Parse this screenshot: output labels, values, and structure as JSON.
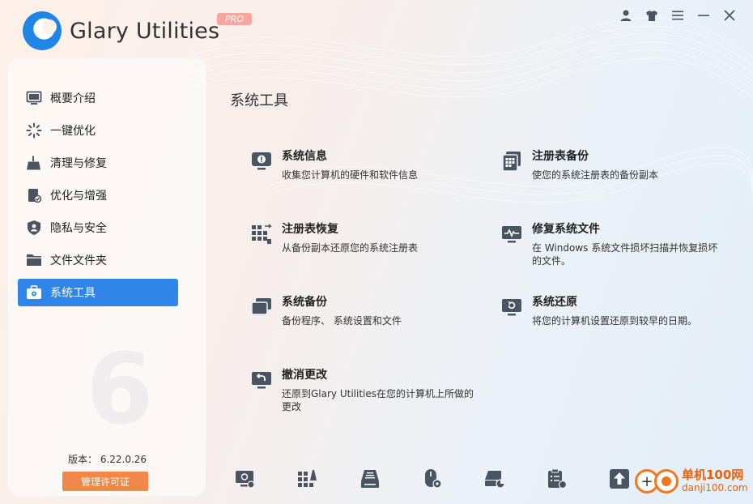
{
  "app": {
    "title": "Glary Utilities",
    "badge": "PRO"
  },
  "titlebar": {
    "icons": [
      "user-icon",
      "skin-icon",
      "menu-icon",
      "minimize-icon",
      "close-icon"
    ]
  },
  "sidebar": {
    "items": [
      {
        "label": "概要介绍",
        "icon": "monitor-icon"
      },
      {
        "label": "一键优化",
        "icon": "sparkle-icon"
      },
      {
        "label": "清理与修复",
        "icon": "broom-icon"
      },
      {
        "label": "优化与增强",
        "icon": "boost-icon"
      },
      {
        "label": "隐私与安全",
        "icon": "shield-icon"
      },
      {
        "label": "文件文件夹",
        "icon": "folder-icon"
      },
      {
        "label": "系统工具",
        "icon": "toolbox-icon",
        "active": true
      }
    ],
    "version_label": "版本： 6.22.0.26",
    "license_button": "管理许可证"
  },
  "main": {
    "section_title": "系统工具",
    "tools": [
      {
        "name": "系统信息",
        "desc": "收集您计算机的硬件和软件信息"
      },
      {
        "name": "注册表备份",
        "desc": "使您的系统注册表的备份副本"
      },
      {
        "name": "注册表恢复",
        "desc": "从备份副本还原您的系统注册表"
      },
      {
        "name": "修复系统文件",
        "desc": "在 Windows 系统文件损坏扫描并恢复损坏的文件。"
      },
      {
        "name": "系统备份",
        "desc": "备份程序、 系统设置和文件"
      },
      {
        "name": "系统还原",
        "desc": "将您的计算机设置还原到较早的日期。"
      },
      {
        "name": "撤消更改",
        "desc": "还原到Glary Utilities在您的计算机上所做的更改"
      }
    ]
  },
  "bottom_bar": {
    "icons": [
      "disk-cleanup-icon",
      "registry-icon",
      "drive-icon",
      "mouse-icon",
      "disk-analysis-icon",
      "checklist-icon",
      "upgrade-icon"
    ]
  },
  "watermark": {
    "cn": "单机100网",
    "url": "danji100.com"
  },
  "colors": {
    "accent": "#2f86e8",
    "license": "#f0884a",
    "pro": "#f7a6a0",
    "icon": "#4a5563"
  }
}
